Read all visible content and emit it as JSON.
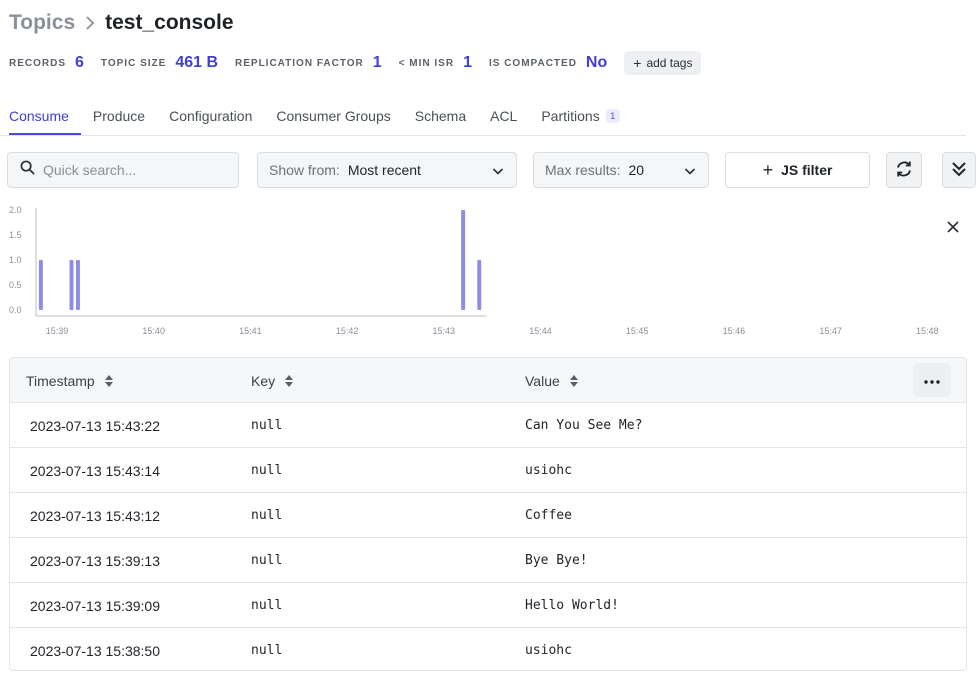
{
  "breadcrumb": {
    "parent": "Topics",
    "current": "test_console"
  },
  "stats": [
    {
      "label": "RECORDS",
      "value": "6"
    },
    {
      "label": "TOPIC SIZE",
      "value": "461 B"
    },
    {
      "label": "REPLICATION FACTOR",
      "value": "1"
    },
    {
      "label": "< MIN ISR",
      "value": "1"
    },
    {
      "label": "IS COMPACTED",
      "value": "No"
    }
  ],
  "add_tags_label": "add tags",
  "tabs": [
    {
      "label": "Consume",
      "active": true
    },
    {
      "label": "Produce"
    },
    {
      "label": "Configuration"
    },
    {
      "label": "Consumer Groups"
    },
    {
      "label": "Schema"
    },
    {
      "label": "ACL"
    },
    {
      "label": "Partitions",
      "badge": "1"
    }
  ],
  "toolbar": {
    "search_placeholder": "Quick search...",
    "show_from_label": "Show from:",
    "show_from_value": "Most recent",
    "max_results_label": "Max results:",
    "max_results_value": "20",
    "js_filter_label": "JS filter"
  },
  "chart_data": {
    "type": "bar",
    "y_ticks": [
      "2.0",
      "1.5",
      "1.0",
      "0.5",
      "0.0"
    ],
    "ylim": [
      0,
      2
    ],
    "x_ticks": [
      "15:39",
      "15:40",
      "15:41",
      "15:42",
      "15:43",
      "15:44",
      "15:45",
      "15:46",
      "15:47",
      "15:48"
    ],
    "bars": [
      {
        "time": "15:38:50",
        "count": 1
      },
      {
        "time": "15:39:09",
        "count": 1
      },
      {
        "time": "15:39:13",
        "count": 1
      },
      {
        "time": "15:43:12",
        "count": 2
      },
      {
        "time": "15:43:22",
        "count": 1
      }
    ],
    "bar_color": "#8f8ce8",
    "grid": false
  },
  "table": {
    "columns": [
      "Timestamp",
      "Key",
      "Value"
    ],
    "rows": [
      {
        "timestamp": "2023-07-13 15:43:22",
        "key": "null",
        "value": "Can You See Me?"
      },
      {
        "timestamp": "2023-07-13 15:43:14",
        "key": "null",
        "value": "usiohc"
      },
      {
        "timestamp": "2023-07-13 15:43:12",
        "key": "null",
        "value": "Coffee"
      },
      {
        "timestamp": "2023-07-13 15:39:13",
        "key": "null",
        "value": "Bye Bye!"
      },
      {
        "timestamp": "2023-07-13 15:39:09",
        "key": "null",
        "value": "Hello World!"
      },
      {
        "timestamp": "2023-07-13 15:38:50",
        "key": "null",
        "value": "usiohc"
      }
    ]
  },
  "colors": {
    "accent": "#3f3fd6",
    "tab_underline": "#4a4ad8",
    "bar": "#8f8ce8"
  }
}
